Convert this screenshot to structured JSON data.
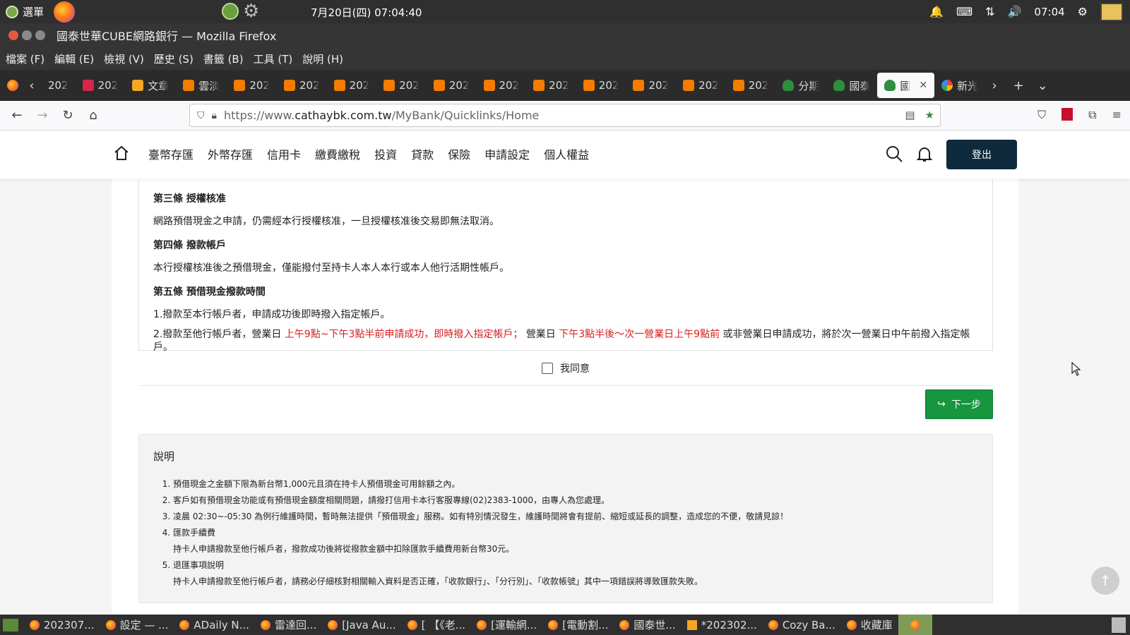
{
  "os_panel": {
    "menu_label": "選單",
    "datetime": "7月20日(四) 07:04:40",
    "tray_time": "07:04"
  },
  "window": {
    "title": "國泰世華CUBE網路銀行 — Mozilla Firefox"
  },
  "menubar": {
    "items": [
      "檔案 (F)",
      "編輯 (E)",
      "檢視 (V)",
      "歷史 (S)",
      "書籤 (B)",
      "工具 (T)",
      "說明 (H)"
    ]
  },
  "tabs": [
    {
      "label": "202",
      "icon": "firefox"
    },
    {
      "label": "202",
      "icon": "red"
    },
    {
      "label": "文章",
      "icon": "orange"
    },
    {
      "label": "雲淡",
      "icon": "blogger"
    },
    {
      "label": "202",
      "icon": "blogger"
    },
    {
      "label": "202",
      "icon": "blogger"
    },
    {
      "label": "202",
      "icon": "blogger"
    },
    {
      "label": "202",
      "icon": "blogger"
    },
    {
      "label": "202",
      "icon": "blogger"
    },
    {
      "label": "202",
      "icon": "blogger"
    },
    {
      "label": "202",
      "icon": "blogger"
    },
    {
      "label": "202",
      "icon": "blogger"
    },
    {
      "label": "202",
      "icon": "blogger"
    },
    {
      "label": "202",
      "icon": "blogger"
    },
    {
      "label": "202",
      "icon": "blogger"
    },
    {
      "label": "分期",
      "icon": "tree"
    },
    {
      "label": "國泰",
      "icon": "tree"
    },
    {
      "label": "國",
      "icon": "tree",
      "active": true
    },
    {
      "label": "新光",
      "icon": "google"
    }
  ],
  "urlbar": {
    "url_prefix": "https://www.",
    "url_domain": "cathaybk.com.tw",
    "url_path": "/MyBank/Quicklinks/Home"
  },
  "site": {
    "nav": [
      "臺幣存匯",
      "外幣存匯",
      "信用卡",
      "繳費繳稅",
      "投資",
      "貸款",
      "保險",
      "申請設定",
      "個人權益"
    ],
    "logout_label": "登出"
  },
  "terms": {
    "art3_title": "第三條 授權核准",
    "art3_body": "網路預借現金之申請，仍需經本行授權核准，一旦授權核准後交易即無法取消。",
    "art4_title": "第四條 撥款帳戶",
    "art4_body": "本行授權核准後之預借現金，僅能撥付至持卡人本人本行或本人他行活期性帳戶。",
    "art5_title": "第五條 預借現金撥款時間",
    "art5_item1": "1.撥款至本行帳戶者，申請成功後即時撥入指定帳戶。",
    "art5_item2_a": "2.撥款至他行帳戶者，營業日",
    "art5_item2_red1": "上午9點~下午3點半前申請成功，即時撥入指定帳戶；",
    "art5_item2_b": "營業日",
    "art5_item2_red2": "下午3點半後～次一營業日上午9點前",
    "art5_item2_c": "或非營業日申請成功，將於次一營業日中午前撥入指定帳戶。"
  },
  "agree": {
    "label": "我同意",
    "checked": false
  },
  "next_button": {
    "label": "下一步"
  },
  "notes": {
    "title": "說明",
    "items": [
      "預借現金之金額下限為新台幣1,000元且須在持卡人預借現金可用餘額之內。",
      "客戶如有預借現金功能或有預借現金額度相關問題，請撥打信用卡本行客服專線(02)2383-1000，由專人為您處理。",
      "凌晨 02:30~-05:30 為例行維護時間，暫時無法提供「預借現金」服務。如有特別情況發生，維護時間將會有提前、縮短或延長的調整，造成您的不便，敬請見諒！",
      "匯款手續費",
      "退匯事項說明"
    ],
    "item4_sub": "持卡人申請撥款至他行帳戶者，撥款成功後將從撥款金額中扣除匯款手續費用新台幣30元。",
    "item5_sub": "持卡人申請撥款至他行帳戶者，請務必仔細核對相關輸入資料是否正確，「收款銀行」、「分行別」、「收款帳號」其中一項錯誤將導致匯款失敗。"
  },
  "taskbar": {
    "tasks": [
      "202307...",
      "設定 — ...",
      "ADaily N...",
      "雷達回...",
      "[Java Au...",
      "[ 【《老...",
      "[運輸網...",
      "[電動割...",
      "國泰世...",
      "*202302...",
      "Cozy Ba...",
      "收藏庫"
    ]
  }
}
